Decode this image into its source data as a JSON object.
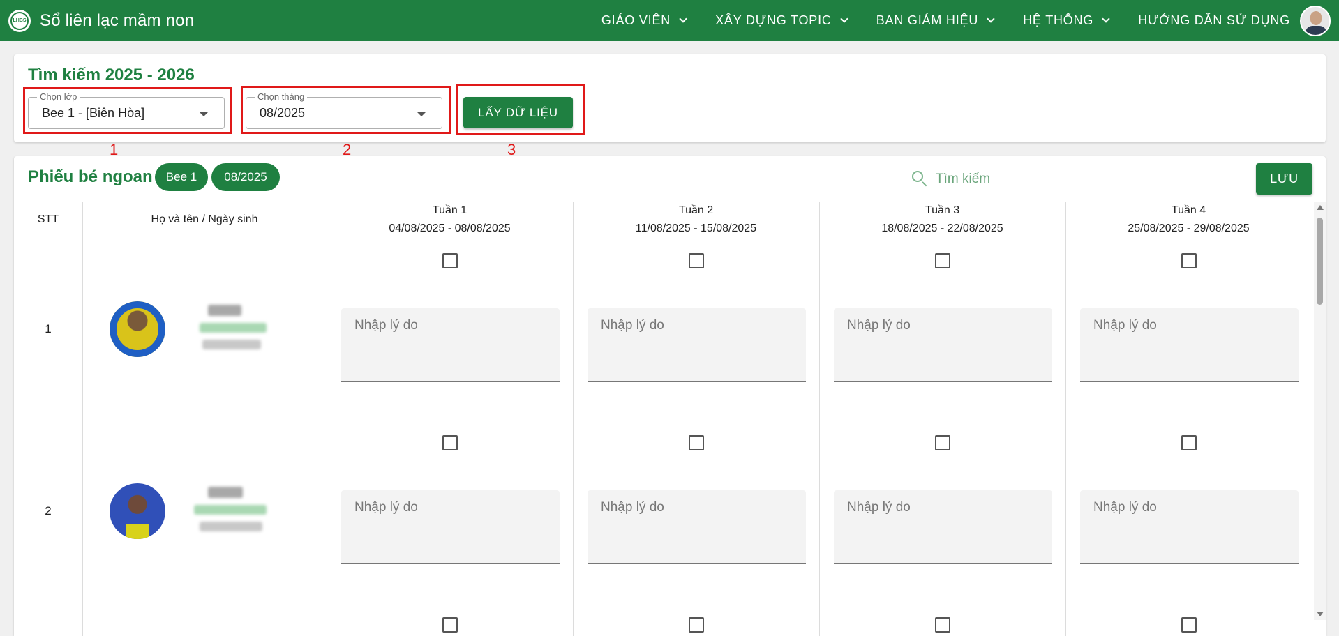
{
  "app": {
    "title": "Sổ liên lạc mầm non",
    "logo_text": "LHBS"
  },
  "nav": [
    {
      "label": "GIÁO VIÊN"
    },
    {
      "label": "XÂY DỰNG TOPIC"
    },
    {
      "label": "BAN GIÁM HIỆU"
    },
    {
      "label": "HỆ THỐNG"
    },
    {
      "label": "HƯỚNG DẪN SỬ DỤNG"
    }
  ],
  "search": {
    "title": "Tìm kiếm 2025 - 2026",
    "class_select": {
      "label": "Chọn lớp",
      "value": "Bee 1 - [Biên Hòa]"
    },
    "month_select": {
      "label": "Chọn tháng",
      "value": "08/2025"
    },
    "fetch_button": "LẤY DỮ LIỆU",
    "annotations": [
      "1",
      "2",
      "3"
    ]
  },
  "sheet": {
    "title": "Phiếu bé ngoan",
    "chips": [
      "Bee 1",
      "08/2025"
    ],
    "search_placeholder": "Tìm kiếm",
    "save_button": "LƯU",
    "columns": {
      "stt": "STT",
      "name": "Họ và tên / Ngày sinh",
      "weeks": [
        {
          "name": "Tuần 1",
          "range": "04/08/2025 - 08/08/2025"
        },
        {
          "name": "Tuần 2",
          "range": "11/08/2025 - 15/08/2025"
        },
        {
          "name": "Tuần 3",
          "range": "18/08/2025 - 22/08/2025"
        },
        {
          "name": "Tuần 4",
          "range": "25/08/2025 - 29/08/2025"
        }
      ]
    },
    "reason_placeholder": "Nhập lý do",
    "rows": [
      {
        "stt": "1",
        "checked": [
          false,
          false,
          false,
          false
        ]
      },
      {
        "stt": "2",
        "checked": [
          false,
          false,
          false,
          false
        ]
      }
    ]
  },
  "colors": {
    "primary": "#1f8041",
    "highlight": "#e01919"
  }
}
